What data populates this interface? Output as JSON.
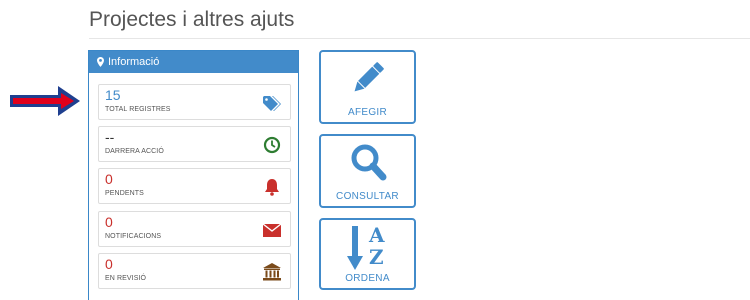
{
  "page": {
    "title": "Projectes i altres ajuts"
  },
  "info_panel": {
    "header": "Informació",
    "stats": [
      {
        "value": "15",
        "label": "TOTAL REGISTRES",
        "icon": "tags-icon",
        "color": "#428bca"
      },
      {
        "value": "--",
        "label": "DARRERA ACCIÓ",
        "icon": "clock-icon",
        "color": "#2e7d32"
      },
      {
        "value": "0",
        "label": "PENDENTS",
        "icon": "bell-icon",
        "color": "#c9302c"
      },
      {
        "value": "0",
        "label": "NOTIFICACIONS",
        "icon": "envelope-icon",
        "color": "#c9302c"
      },
      {
        "value": "0",
        "label": "EN REVISIÓ",
        "icon": "bank-icon",
        "color": "#7a4a1a"
      }
    ]
  },
  "actions": {
    "add_label": "AFEGIR",
    "consult_label": "CONSULTAR",
    "sort_label": "ORDENA",
    "sort_glyph_top": "A",
    "sort_glyph_bottom": "Z"
  },
  "colors": {
    "primary": "#428bca",
    "arrow_fill": "#e0001b",
    "arrow_outline": "#1f3f8f"
  }
}
